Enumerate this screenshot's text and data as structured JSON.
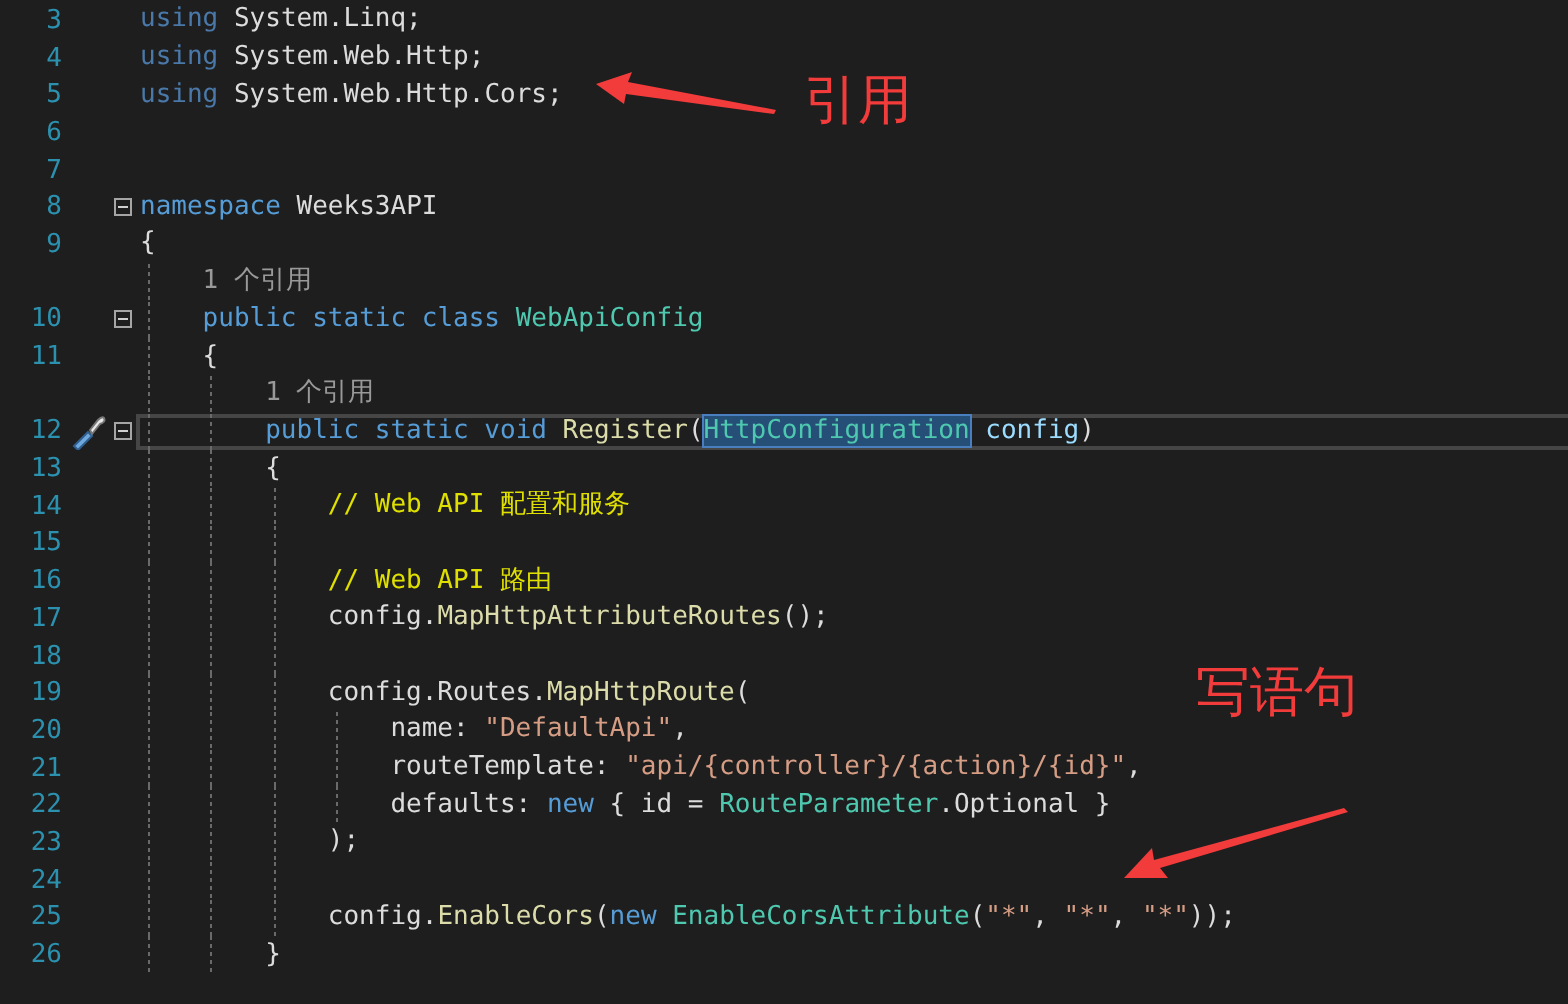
{
  "editor": {
    "lines": [
      {
        "kind": "code",
        "number": "3",
        "tokens": [
          {
            "kind": "faded",
            "text": "using"
          },
          {
            "kind": "plain",
            "text": " System.Linq;"
          }
        ]
      },
      {
        "kind": "code",
        "number": "4",
        "tokens": [
          {
            "kind": "faded",
            "text": "using"
          },
          {
            "kind": "plain",
            "text": " System.Web.Http;"
          }
        ]
      },
      {
        "kind": "code",
        "number": "5",
        "tokens": [
          {
            "kind": "faded",
            "text": "using"
          },
          {
            "kind": "plain",
            "text": " System.Web.Http.Cors;"
          }
        ]
      },
      {
        "kind": "code",
        "number": "6"
      },
      {
        "kind": "code",
        "number": "7"
      },
      {
        "kind": "code",
        "number": "8",
        "expanded": true,
        "tokens": [
          {
            "kind": "keyword",
            "text": "namespace"
          },
          {
            "kind": "plain",
            "text": " Weeks3API"
          }
        ]
      },
      {
        "kind": "code",
        "number": "9",
        "tokens": [
          {
            "kind": "plain",
            "text": "{"
          }
        ],
        "children": [
          {
            "kind": "codelens",
            "text": "1 个引用"
          },
          {
            "kind": "code",
            "number": "10",
            "expanded": true,
            "tokens": [
              {
                "kind": "keyword",
                "text": "public static class"
              },
              {
                "kind": "type",
                "text": " WebApiConfig"
              }
            ]
          },
          {
            "kind": "code",
            "number": "11",
            "tokens": [
              {
                "kind": "plain",
                "text": "{"
              }
            ],
            "children": [
              {
                "kind": "codelens",
                "text": "1 个引用"
              },
              {
                "kind": "code",
                "number": "12",
                "expanded": true,
                "current": true,
                "quick_action": true,
                "tokens": [
                  {
                    "kind": "keyword",
                    "text": "public static void"
                  },
                  {
                    "kind": "method",
                    "text": " Register"
                  },
                  {
                    "kind": "plain",
                    "text": "("
                  },
                  {
                    "kind": "type",
                    "text": "HttpConfiguration",
                    "selected": true
                  },
                  {
                    "kind": "param",
                    "text": " config"
                  },
                  {
                    "kind": "plain",
                    "text": ")"
                  }
                ]
              },
              {
                "kind": "code",
                "number": "13",
                "tokens": [
                  {
                    "kind": "plain",
                    "text": "{"
                  }
                ],
                "children": [
                  {
                    "kind": "code",
                    "number": "14",
                    "tokens": [
                      {
                        "kind": "comment",
                        "text": "// Web API 配置和服务"
                      }
                    ]
                  },
                  {
                    "kind": "code",
                    "number": "15"
                  },
                  {
                    "kind": "code",
                    "number": "16",
                    "tokens": [
                      {
                        "kind": "comment",
                        "text": "// Web API 路由"
                      }
                    ]
                  },
                  {
                    "kind": "code",
                    "number": "17",
                    "tokens": [
                      {
                        "kind": "plain",
                        "text": "config."
                      },
                      {
                        "kind": "method",
                        "text": "MapHttpAttributeRoutes"
                      },
                      {
                        "kind": "plain",
                        "text": "();"
                      }
                    ]
                  },
                  {
                    "kind": "code",
                    "number": "18"
                  },
                  {
                    "kind": "code",
                    "number": "19",
                    "tokens": [
                      {
                        "kind": "plain",
                        "text": "config.Routes."
                      },
                      {
                        "kind": "method",
                        "text": "MapHttpRoute"
                      },
                      {
                        "kind": "plain",
                        "text": "("
                      }
                    ],
                    "children": [
                      {
                        "kind": "code",
                        "number": "20",
                        "tokens": [
                          {
                            "kind": "plain",
                            "text": "name: "
                          },
                          {
                            "kind": "string",
                            "text": "\"DefaultApi\""
                          },
                          {
                            "kind": "plain",
                            "text": ","
                          }
                        ]
                      },
                      {
                        "kind": "code",
                        "number": "21",
                        "tokens": [
                          {
                            "kind": "plain",
                            "text": "routeTemplate: "
                          },
                          {
                            "kind": "string",
                            "text": "\"api/{controller}/{action}/{id}\""
                          },
                          {
                            "kind": "plain",
                            "text": ","
                          }
                        ]
                      },
                      {
                        "kind": "code",
                        "number": "22",
                        "tokens": [
                          {
                            "kind": "plain",
                            "text": "defaults: "
                          },
                          {
                            "kind": "keyword",
                            "text": "new"
                          },
                          {
                            "kind": "plain",
                            "text": " { id = "
                          },
                          {
                            "kind": "type",
                            "text": "RouteParameter"
                          },
                          {
                            "kind": "plain",
                            "text": ".Optional }"
                          }
                        ]
                      }
                    ]
                  },
                  {
                    "kind": "code",
                    "number": "23",
                    "tokens": [
                      {
                        "kind": "plain",
                        "text": ");"
                      }
                    ]
                  },
                  {
                    "kind": "code",
                    "number": "24"
                  },
                  {
                    "kind": "code",
                    "number": "25",
                    "tokens": [
                      {
                        "kind": "plain",
                        "text": "config."
                      },
                      {
                        "kind": "method",
                        "text": "EnableCors"
                      },
                      {
                        "kind": "plain",
                        "text": "("
                      },
                      {
                        "kind": "keyword",
                        "text": "new"
                      },
                      {
                        "kind": "type",
                        "text": " EnableCorsAttribute"
                      },
                      {
                        "kind": "plain",
                        "text": "("
                      },
                      {
                        "kind": "string",
                        "text": "\"*\""
                      },
                      {
                        "kind": "plain",
                        "text": ", "
                      },
                      {
                        "kind": "string",
                        "text": "\"*\""
                      },
                      {
                        "kind": "plain",
                        "text": ", "
                      },
                      {
                        "kind": "string",
                        "text": "\"*\""
                      },
                      {
                        "kind": "plain",
                        "text": "));"
                      }
                    ]
                  }
                ]
              },
              {
                "kind": "code",
                "number": "26",
                "tokens": [
                  {
                    "kind": "plain",
                    "text": "}"
                  }
                ]
              }
            ]
          }
        ]
      }
    ]
  },
  "annotations": [
    {
      "text": "引用"
    },
    {
      "text": "写语句"
    }
  ]
}
